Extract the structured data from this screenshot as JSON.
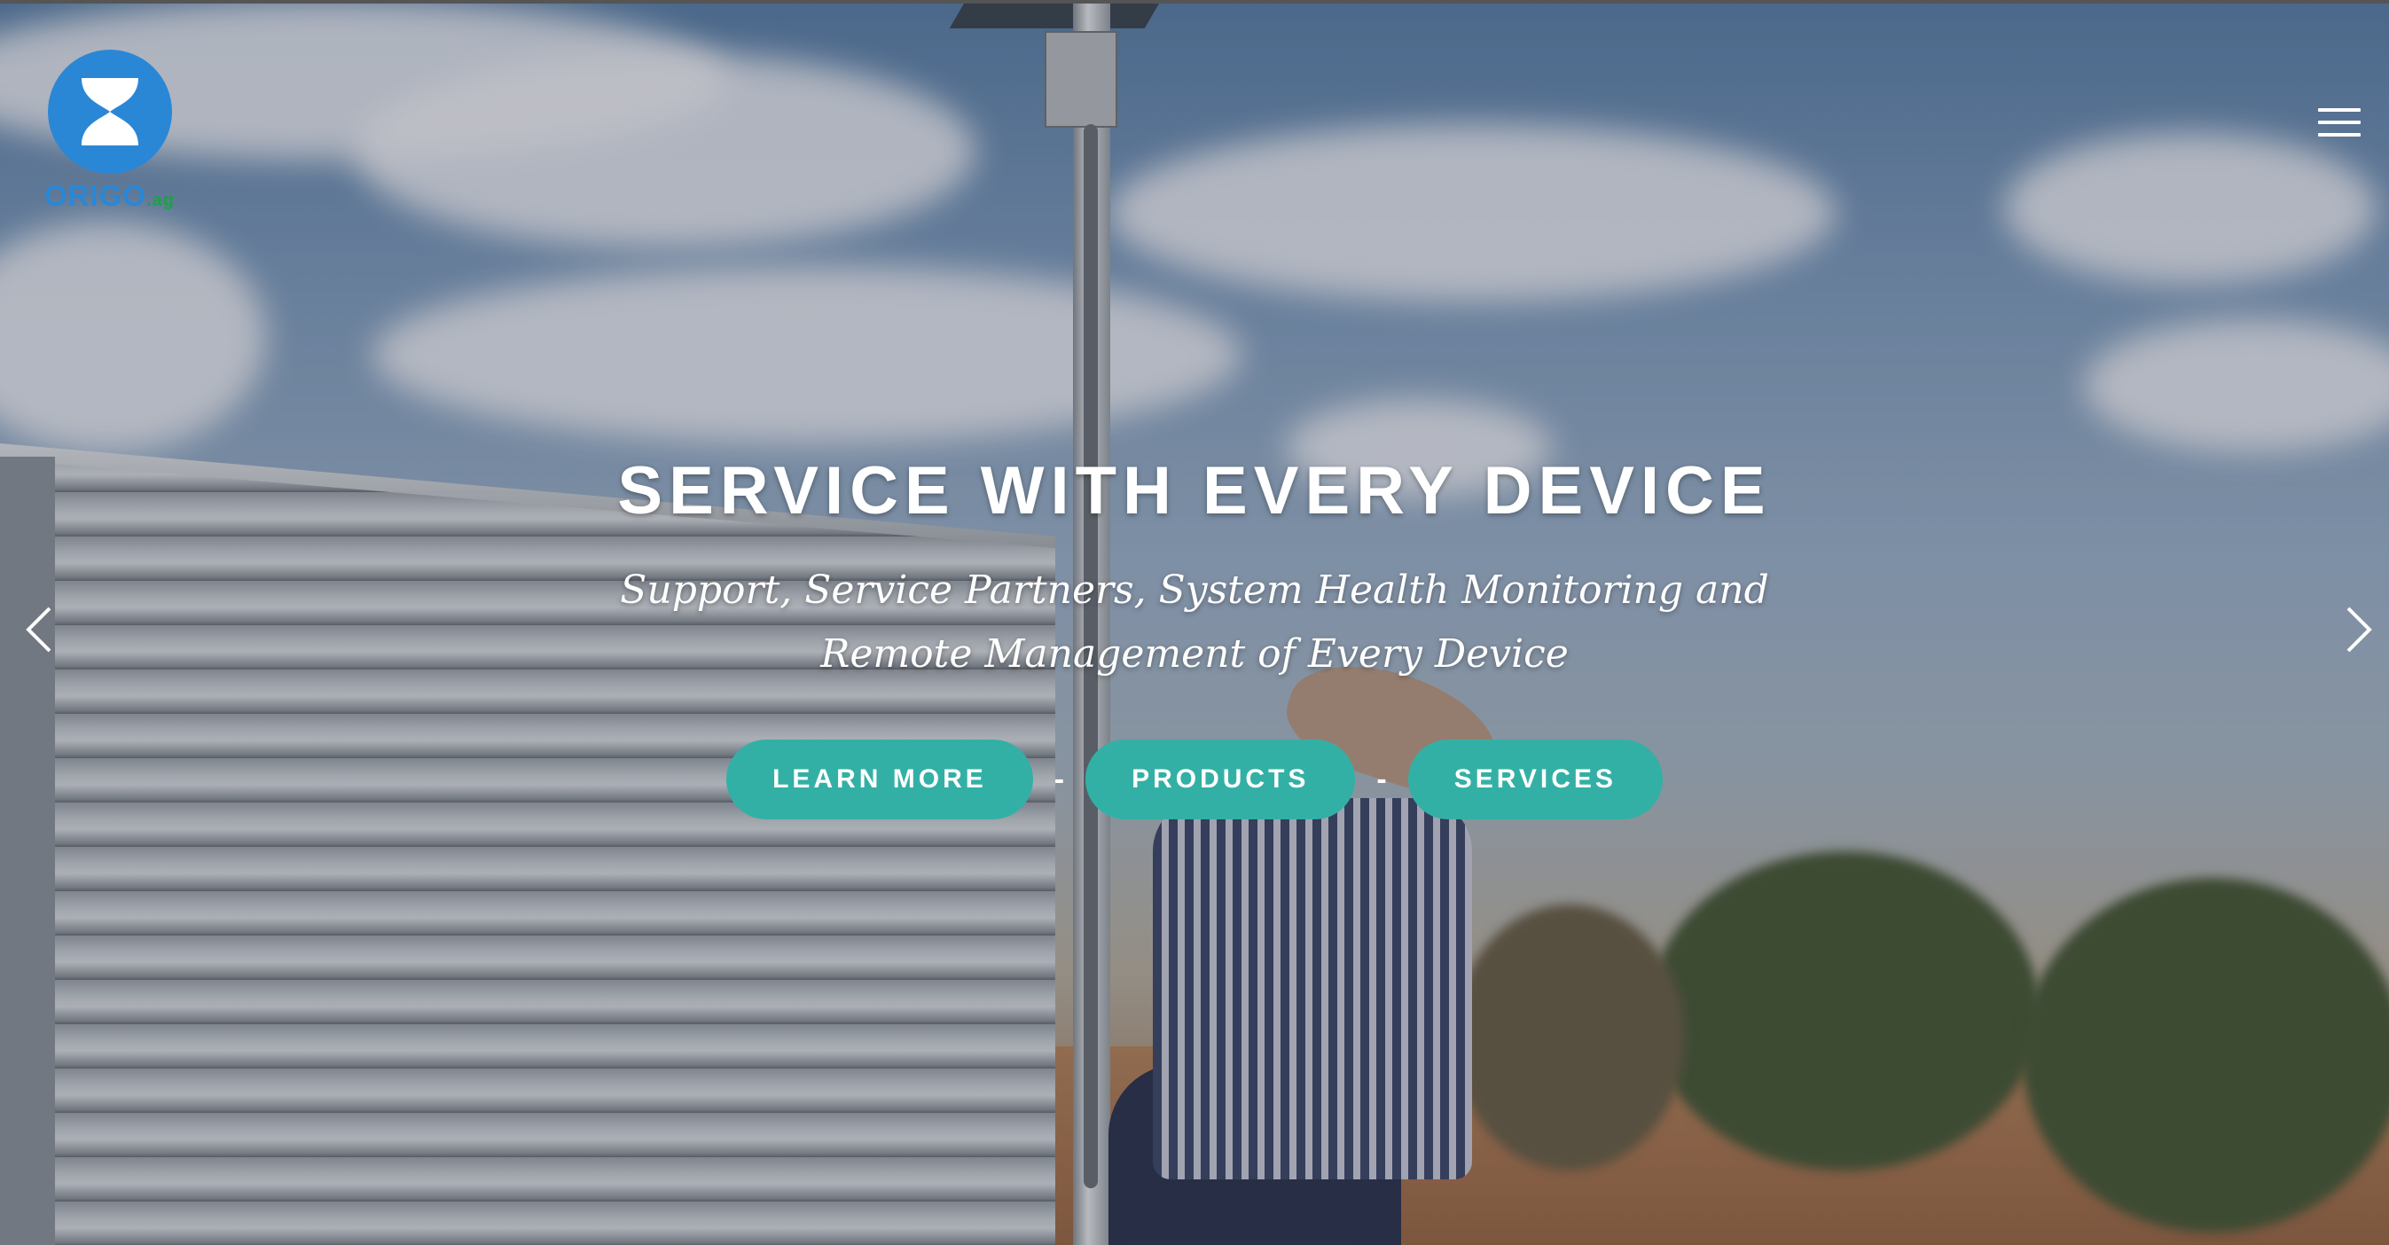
{
  "brand": {
    "logo_text": "ORIGO",
    "logo_suffix": ".ag",
    "primary_color": "#2a87d6",
    "accent_color": "#1aa345"
  },
  "nav": {
    "menu_icon": "hamburger-menu-icon"
  },
  "hero": {
    "headline": "SERVICE WITH EVERY DEVICE",
    "subtitle": "Support, Service Partners, System Health Monitoring and Remote Management of Every Device",
    "buttons": {
      "learn_more": "LEARN MORE",
      "products": "PRODUCTS",
      "services": "SERVICES"
    },
    "separator": "-",
    "button_color": "#33b0a5"
  },
  "carousel": {
    "prev_icon": "chevron-left-icon",
    "next_icon": "chevron-right-icon"
  }
}
